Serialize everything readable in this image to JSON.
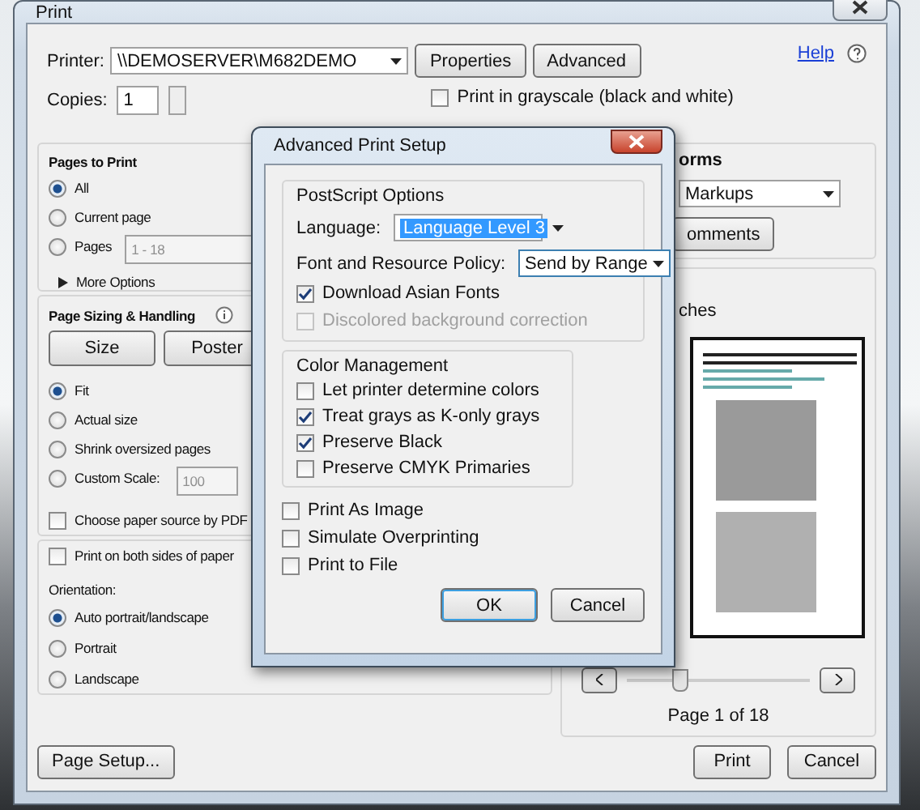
{
  "window": {
    "title": "Print",
    "help": "Help"
  },
  "printer": {
    "label": "Printer:",
    "value": "\\\\DEMOSERVER\\M682DEMO",
    "buttons": [
      "Properties",
      "Advanced"
    ]
  },
  "copies": {
    "label": "Copies:",
    "value": "1"
  },
  "grayscale": {
    "label": "Print in grayscale (black and white)",
    "checked": false
  },
  "pages_to_print": {
    "title": "Pages to Print",
    "options": [
      {
        "label": "All",
        "selected": true
      },
      {
        "label": "Current page",
        "selected": false
      },
      {
        "label": "Pages",
        "selected": false,
        "value": "1 - 18",
        "disabled": true
      }
    ],
    "more_options": "More Options"
  },
  "page_sizing": {
    "title": "Page Sizing & Handling",
    "buttons": [
      "Size",
      "Poster"
    ],
    "options": [
      {
        "label": "Fit",
        "selected": true
      },
      {
        "label": "Actual size",
        "selected": false
      },
      {
        "label": "Shrink oversized pages",
        "selected": false
      },
      {
        "label": "Custom Scale:",
        "selected": false,
        "value": "100",
        "disabled": true
      }
    ],
    "paper_source": {
      "label": "Choose paper source by PDF",
      "checked": false
    }
  },
  "duplex": {
    "label": "Print on both sides of paper",
    "checked": false
  },
  "orientation": {
    "label": "Orientation:",
    "options": [
      {
        "label": "Auto portrait/landscape",
        "selected": true
      },
      {
        "label": "Portrait",
        "selected": false
      },
      {
        "label": "Landscape",
        "selected": false
      }
    ]
  },
  "comments_forms": {
    "title": "orms",
    "select": "Markups",
    "button": "omments"
  },
  "preview": {
    "label": "ches",
    "page": "Page 1 of 18"
  },
  "footer": {
    "page_setup": "Page Setup...",
    "print": "Print",
    "cancel": "Cancel"
  },
  "advanced": {
    "title": "Advanced Print Setup",
    "postscript": {
      "title": "PostScript Options",
      "language_label": "Language:",
      "language": "Language Level 3",
      "policy_label": "Font and Resource Policy:",
      "policy": "Send by Range",
      "checks": [
        {
          "label": "Download Asian Fonts",
          "checked": true,
          "disabled": false
        },
        {
          "label": "Discolored background correction",
          "checked": false,
          "disabled": true
        }
      ]
    },
    "color": {
      "title": "Color Management",
      "checks": [
        {
          "label": "Let printer determine colors",
          "checked": false
        },
        {
          "label": "Treat grays as K-only grays",
          "checked": true
        },
        {
          "label": "Preserve Black",
          "checked": true
        },
        {
          "label": "Preserve CMYK Primaries",
          "checked": false
        }
      ]
    },
    "checks": [
      {
        "label": "Print As Image",
        "checked": false
      },
      {
        "label": "Simulate Overprinting",
        "checked": false
      },
      {
        "label": "Print to File",
        "checked": false
      }
    ],
    "ok": "OK",
    "cancel": "Cancel"
  }
}
